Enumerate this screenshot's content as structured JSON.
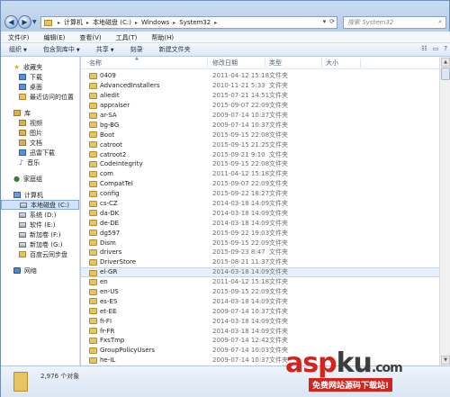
{
  "address": {
    "crumbs": [
      "计算机",
      "本地磁盘 (C:)",
      "Windows",
      "System32"
    ],
    "search_placeholder": "搜索 System32"
  },
  "menu": [
    "文件(F)",
    "编辑(E)",
    "查看(V)",
    "工具(T)",
    "帮助(H)"
  ],
  "toolbar": {
    "organize": "组织",
    "include": "包含到库中",
    "share": "共享",
    "burn": "刻录",
    "new_folder": "新建文件夹"
  },
  "sidebar": {
    "favorites": "收藏夹",
    "downloads": "下载",
    "desktop": "桌面",
    "recent": "最近访问的位置",
    "libraries": "库",
    "videos": "视频",
    "pictures": "图片",
    "documents": "文档",
    "xunlei": "迅雷下载",
    "music": "音乐",
    "homegroup": "家庭组",
    "computer": "计算机",
    "drive_c": "本地磁盘 (C:)",
    "drive_d": "系统 (D:)",
    "drive_e": "软件 (E:)",
    "drive_f": "新加卷 (F:)",
    "drive_g": "新加卷 (G:)",
    "baidu": "百度云同步盘",
    "network": "网络"
  },
  "columns": {
    "name": "名称",
    "date": "修改日期",
    "type": "类型",
    "size": "大小"
  },
  "files": [
    {
      "name": "0409",
      "date": "2011-04-12 15:18",
      "type": "文件夹"
    },
    {
      "name": "AdvancedInstallers",
      "date": "2010-11-21 5:33",
      "type": "文件夹"
    },
    {
      "name": "aliedit",
      "date": "2015-07-21 14:51",
      "type": "文件夹"
    },
    {
      "name": "appraiser",
      "date": "2015-09-07 22:09",
      "type": "文件夹"
    },
    {
      "name": "ar-SA",
      "date": "2009-07-14 10:37",
      "type": "文件夹"
    },
    {
      "name": "bg-BG",
      "date": "2009-07-14 10:37",
      "type": "文件夹"
    },
    {
      "name": "Boot",
      "date": "2015-09-15 22:08",
      "type": "文件夹"
    },
    {
      "name": "catroot",
      "date": "2015-09-15 21:25",
      "type": "文件夹"
    },
    {
      "name": "catroot2",
      "date": "2015-09-21 9:10",
      "type": "文件夹"
    },
    {
      "name": "CodeIntegrity",
      "date": "2015-09-15 22:08",
      "type": "文件夹"
    },
    {
      "name": "com",
      "date": "2011-04-12 15:18",
      "type": "文件夹"
    },
    {
      "name": "CompatTel",
      "date": "2015-09-07 22:09",
      "type": "文件夹"
    },
    {
      "name": "config",
      "date": "2015-09-22 18:27",
      "type": "文件夹"
    },
    {
      "name": "cs-CZ",
      "date": "2014-03-18 14:09",
      "type": "文件夹"
    },
    {
      "name": "da-DK",
      "date": "2014-03-18 14:09",
      "type": "文件夹"
    },
    {
      "name": "de-DE",
      "date": "2014-03-18 14:09",
      "type": "文件夹"
    },
    {
      "name": "dg597",
      "date": "2015-09-22 19:03",
      "type": "文件夹"
    },
    {
      "name": "Dism",
      "date": "2015-09-15 22:09",
      "type": "文件夹"
    },
    {
      "name": "drivers",
      "date": "2015-09-23 8:47",
      "type": "文件夹"
    },
    {
      "name": "DriverStore",
      "date": "2015-08-21 11:37",
      "type": "文件夹"
    },
    {
      "name": "el-GR",
      "date": "2014-03-18 14:09",
      "type": "文件夹",
      "selected": true
    },
    {
      "name": "en",
      "date": "2011-04-12 15:18",
      "type": "文件夹"
    },
    {
      "name": "en-US",
      "date": "2015-09-15 22:09",
      "type": "文件夹"
    },
    {
      "name": "es-ES",
      "date": "2014-03-18 14:09",
      "type": "文件夹"
    },
    {
      "name": "et-EE",
      "date": "2009-07-14 10:37",
      "type": "文件夹"
    },
    {
      "name": "fi-FI",
      "date": "2014-03-18 14:09",
      "type": "文件夹"
    },
    {
      "name": "fr-FR",
      "date": "2014-03-18 14:09",
      "type": "文件夹"
    },
    {
      "name": "FxsTmp",
      "date": "2009-07-14 12:42",
      "type": "文件夹"
    },
    {
      "name": "GroupPolicyUsers",
      "date": "2009-07-14 10:03",
      "type": "文件夹"
    },
    {
      "name": "he-IL",
      "date": "2009-07-14 10:37",
      "type": "文件夹"
    }
  ],
  "status": {
    "count": "2,976 个对象"
  },
  "watermark": {
    "brand_a": "asp",
    "brand_b": "ku",
    "brand_c": ".com",
    "tagline": "免费网站源码下载站!"
  }
}
